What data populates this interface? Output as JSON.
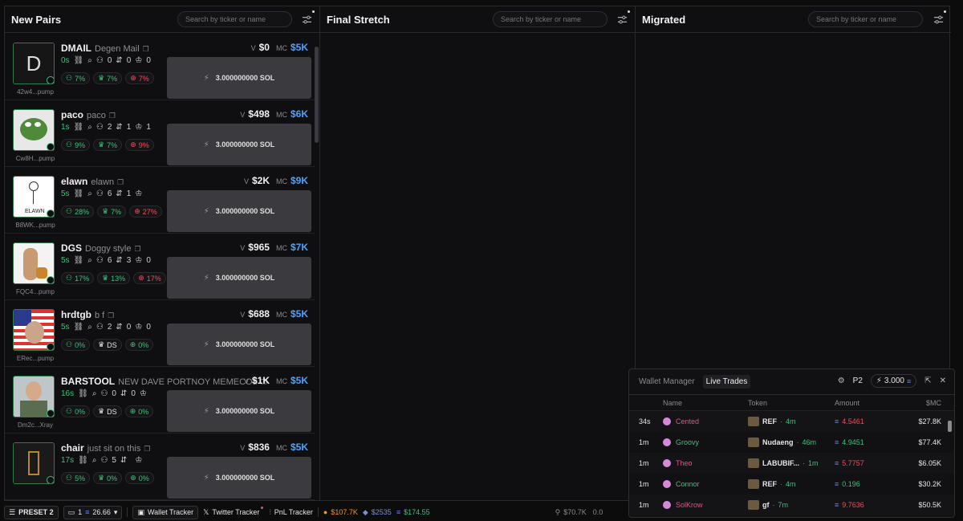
{
  "columns": {
    "new_pairs": {
      "title": "New Pairs",
      "search_placeholder": "Search by ticker or name"
    },
    "final_stretch": {
      "title": "Final Stretch",
      "search_placeholder": "Search by ticker or name"
    },
    "migrated": {
      "title": "Migrated",
      "search_placeholder": "Search by ticker or name"
    }
  },
  "buy_label": "3.000000000 SOL",
  "cards": [
    {
      "symbol": "DMAIL",
      "name": "Degen Mail",
      "addr": "42w4...pump",
      "age": "0s",
      "holders": "0",
      "c2": "0",
      "c3": "0",
      "v": "$0",
      "mc": "$5K",
      "p1": "7%",
      "p2": "7%",
      "p3": "7%",
      "p3color": "r",
      "p2label": "",
      "avatar": "D"
    },
    {
      "symbol": "paco",
      "name": "paco",
      "addr": "Cw8H...pump",
      "age": "1s",
      "holders": "2",
      "c2": "1",
      "c3": "1",
      "v": "$498",
      "mc": "$6K",
      "p1": "9%",
      "p2": "7%",
      "p3": "9%",
      "p3color": "r",
      "p2label": "",
      "avatar": "frog"
    },
    {
      "symbol": "elawn",
      "name": "elawn",
      "addr": "B8WK...pump",
      "age": "5s",
      "holders": "6",
      "c2": "1",
      "c3": "",
      "v": "$2K",
      "mc": "$9K",
      "p1": "28%",
      "p2": "7%",
      "p3": "27%",
      "p3color": "r",
      "p2label": "",
      "avatar": "stick"
    },
    {
      "symbol": "DGS",
      "name": "Doggy style",
      "addr": "FQC4...pump",
      "age": "5s",
      "holders": "6",
      "c2": "3",
      "c3": "0",
      "v": "$965",
      "mc": "$7K",
      "p1": "17%",
      "p2": "13%",
      "p3": "17%",
      "p3color": "r",
      "p2label": "",
      "avatar": "dog"
    },
    {
      "symbol": "hrdtgb",
      "name": "b f",
      "addr": "ERec...pump",
      "age": "5s",
      "holders": "2",
      "c2": "0",
      "c3": "0",
      "v": "$688",
      "mc": "$5K",
      "p1": "0%",
      "p2": "DS",
      "p3": "0%",
      "p3color": "g",
      "p2label": "DS",
      "avatar": "flag"
    },
    {
      "symbol": "BARSTOOL",
      "name": "NEW DAVE PORTNOY MEMECOII",
      "addr": "Dm2c...Xray",
      "age": "16s",
      "holders": "0",
      "c2": "0",
      "c3": "",
      "v": "$1K",
      "mc": "$5K",
      "p1": "0%",
      "p2": "DS",
      "p3": "0%",
      "p3color": "g",
      "p2label": "DS",
      "avatar": "man"
    },
    {
      "symbol": "chair",
      "name": "just sit on this",
      "addr": "",
      "age": "17s",
      "holders": "5",
      "c2": "",
      "c3": "",
      "v": "$836",
      "mc": "$5K",
      "p1": "5%",
      "p2": "0%",
      "p3": "0%",
      "p3color": "g",
      "p2label": "",
      "avatar": "chair"
    }
  ],
  "bottom_bar": {
    "preset": "PRESET 2",
    "wallet_count": "1",
    "balance": "26.66",
    "wallet_tracker": "Wallet Tracker",
    "twitter_tracker": "Twitter Tracker",
    "pnl_tracker": "PnL Tracker",
    "btc": "$107.7K",
    "eth": "$2535",
    "sol": "$174.55",
    "right_stat": "$70.7K",
    "right_stat2": "0.0"
  },
  "panel": {
    "tab_wallet": "Wallet Manager",
    "tab_live": "Live Trades",
    "preset": "P2",
    "amount": "3.000",
    "headers": {
      "name": "Name",
      "token": "Token",
      "amount": "Amount",
      "mc": "$MC"
    },
    "rows": [
      {
        "age": "34s",
        "name": "Cented",
        "name_color": "#ef4d8a",
        "token": "REF",
        "token_age": "4m",
        "amount": "4.5461",
        "amount_color": "#ef4d5f",
        "mc": "$27.8K"
      },
      {
        "age": "1m",
        "name": "Groovy",
        "name_color": "#3ec07a",
        "token": "Nudaeng",
        "token_age": "46m",
        "amount": "4.9451",
        "amount_color": "#3ec07a",
        "mc": "$77.4K"
      },
      {
        "age": "1m",
        "name": "Theo",
        "name_color": "#ef4d8a",
        "token": "LABUBIF...",
        "token_age": "1m",
        "amount": "5.7757",
        "amount_color": "#ef4d5f",
        "mc": "$6.05K"
      },
      {
        "age": "1m",
        "name": "Connor",
        "name_color": "#3ec07a",
        "token": "REF",
        "token_age": "4m",
        "amount": "0.196",
        "amount_color": "#3ec07a",
        "mc": "$30.2K"
      },
      {
        "age": "1m",
        "name": "SolKrow",
        "name_color": "#ef4d8a",
        "token": "gf",
        "token_age": "7m",
        "amount": "9.7636",
        "amount_color": "#ef4d5f",
        "mc": "$50.5K"
      }
    ]
  }
}
